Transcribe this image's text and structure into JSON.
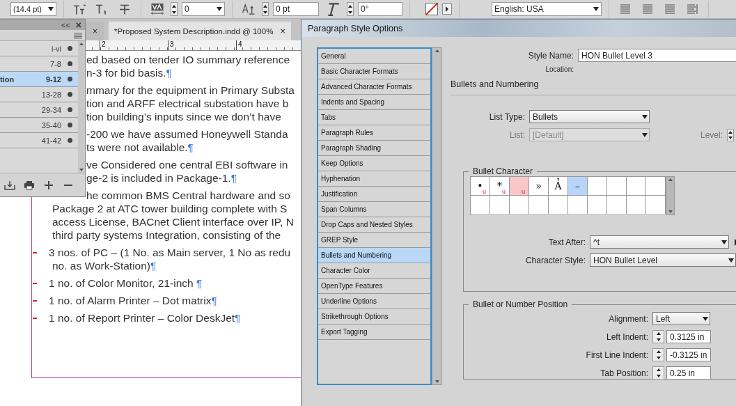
{
  "toolbar": {
    "font_size": "(14.4 pt)",
    "tracking": "0",
    "baseline_shift": "0 pt",
    "skew": "0°",
    "language": "English: USA"
  },
  "document_tabs": [
    {
      "label": "×",
      "selected": false
    },
    {
      "label": "*Proposed System Description.indd @ 100%",
      "close": "×",
      "selected": true
    }
  ],
  "ruler": {
    "ticks": [
      "2",
      "3",
      "4"
    ]
  },
  "book_panel": {
    "collapse": "<<",
    "close": "×",
    "rows": [
      {
        "pages": "i-vi",
        "selected": false
      },
      {
        "pages": "7-8",
        "selected": false
      },
      {
        "name": "tion",
        "pages": "9-12",
        "selected": true
      },
      {
        "pages": "13-28",
        "selected": false
      },
      {
        "pages": "29-34",
        "selected": false
      },
      {
        "pages": "35-40",
        "selected": false
      },
      {
        "pages": "41-42",
        "selected": false
      }
    ]
  },
  "document": {
    "paragraphs": [
      {
        "kind": "body",
        "lines": [
          {
            "text": "ed based on tender IO summary reference",
            "clipped": true
          },
          {
            "text": "n-3 for bid basis.",
            "end": "¶",
            "clipped": true
          }
        ]
      },
      {
        "kind": "body",
        "lines": [
          {
            "text": "mmary for the equipment in Primary Substa",
            "clipped": true
          },
          {
            "text": "tion and ARFF electrical substation have b",
            "clipped": true
          },
          {
            "text": "tion building’s inputs since we don’t have",
            "clipped": true
          }
        ]
      },
      {
        "kind": "body",
        "lines": [
          {
            "text": "-200 we have assumed Honeywell Standa",
            "clipped": true
          },
          {
            "text": "ts were not available.",
            "end": "¶",
            "clipped": true
          }
        ]
      },
      {
        "kind": "body",
        "lines": [
          {
            "text": "ve Considered one central EBI software in",
            "clipped": true
          },
          {
            "text": "ge-2 is included in Package-1.",
            "end": "¶",
            "clipped": true
          }
        ]
      },
      {
        "kind": "body",
        "lines": [
          {
            "text": "he common BMS Central hardware and so",
            "clipped": true
          },
          {
            "text": "Package 2 at ATC tower building complete with S",
            "clipped": false
          },
          {
            "text": "access License, BACnet Client interface over IP, N",
            "clipped": false
          },
          {
            "text": "third party systems Integration, consisting of the",
            "clipped": false
          }
        ]
      },
      {
        "kind": "bullet",
        "lines": [
          {
            "text": "3 nos. of PC – (1 No. as Main server, 1 No as redu"
          },
          {
            "text": "no. as Work-Station)",
            "end": "¶"
          }
        ]
      },
      {
        "kind": "bullet",
        "lines": [
          {
            "text": "1 no. of Color Monitor, 21-inch ",
            "end": "¶"
          }
        ]
      },
      {
        "kind": "bullet",
        "lines": [
          {
            "text": "1 no. of Alarm Printer – Dot matrix",
            "end": "¶"
          }
        ]
      },
      {
        "kind": "bullet",
        "lines": [
          {
            "text": "1 no. of Report Printer – Color DeskJet",
            "end": "¶"
          }
        ]
      }
    ]
  },
  "dialog": {
    "title": "Paragraph Style Options",
    "categories": [
      {
        "label": "General",
        "selected": false
      },
      {
        "label": "Basic Character Formats",
        "selected": false
      },
      {
        "label": "Advanced Character Formats",
        "selected": false
      },
      {
        "label": "Indents and Spacing",
        "selected": false
      },
      {
        "label": "Tabs",
        "selected": false
      },
      {
        "label": "Paragraph Rules",
        "selected": false
      },
      {
        "label": "Paragraph Shading",
        "selected": false
      },
      {
        "label": "Keep Options",
        "selected": false
      },
      {
        "label": "Hyphenation",
        "selected": false
      },
      {
        "label": "Justification",
        "selected": false
      },
      {
        "label": "Span Columns",
        "selected": false
      },
      {
        "label": "Drop Caps and Nested Styles",
        "selected": false
      },
      {
        "label": "GREP Style",
        "selected": false
      },
      {
        "label": "Bullets and Numbering",
        "selected": true
      },
      {
        "label": "Character Color",
        "selected": false
      },
      {
        "label": "OpenType Features",
        "selected": false
      },
      {
        "label": "Underline Options",
        "selected": false
      },
      {
        "label": "Strikethrough Options",
        "selected": false
      },
      {
        "label": "Export Tagging",
        "selected": false
      }
    ],
    "style_name_label": "Style Name:",
    "style_name": "HON Bullet Level 3",
    "location_label": "Location:",
    "section_title": "Bullets and Numbering",
    "list_type": {
      "label": "List Type:",
      "value": "Bullets",
      "disabled": false
    },
    "list": {
      "label": "List:",
      "value": "[Default]",
      "disabled": true
    },
    "level_label": "Level:",
    "bullet_character": {
      "title": "Bullet Character",
      "cells": [
        {
          "char": "•",
          "flag": "u",
          "missing": false,
          "selected": false
        },
        {
          "char": "*",
          "flag": "u",
          "missing": false,
          "selected": false
        },
        {
          "flag": "u",
          "missing": true,
          "selected": false
        },
        {
          "char": "»",
          "missing": false,
          "selected": false
        },
        {
          "char": "Ả",
          "missing": false,
          "selected": false
        },
        {
          "char": "–",
          "missing": false,
          "selected": true
        }
      ]
    },
    "text_after": {
      "label": "Text After:",
      "value": "^t"
    },
    "character_style": {
      "label": "Character Style:",
      "value": "HON Bullet Level"
    },
    "position": {
      "title": "Bullet or Number Position",
      "alignment": {
        "label": "Alignment:",
        "value": "Left"
      },
      "fields": [
        {
          "label": "Left Indent:",
          "value": "0.3125 in"
        },
        {
          "label": "First Line Indent:",
          "value": "-0.3125 in"
        },
        {
          "label": "Tab Position:",
          "value": "0.25 in"
        }
      ]
    }
  }
}
